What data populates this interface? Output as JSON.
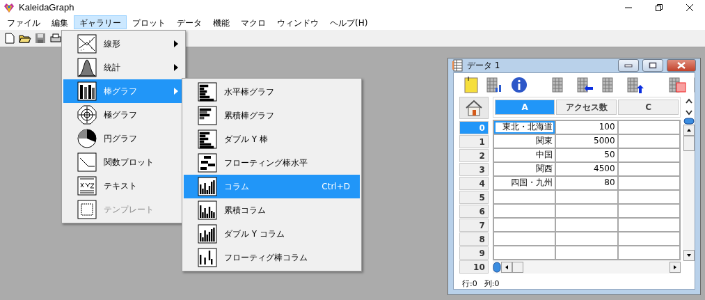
{
  "window": {
    "title": "KaleidaGraph"
  },
  "menu_bar": [
    {
      "label": "ファイル",
      "selected": false
    },
    {
      "label": "編集",
      "selected": false
    },
    {
      "label": "ギャラリー",
      "selected": true
    },
    {
      "label": "プロット",
      "selected": false
    },
    {
      "label": "データ",
      "selected": false
    },
    {
      "label": "機能",
      "selected": false
    },
    {
      "label": "マクロ",
      "selected": false
    },
    {
      "label": "ウィンドウ",
      "selected": false
    },
    {
      "label": "ヘルプ(H)",
      "selected": false
    }
  ],
  "gallery_menu": {
    "items": [
      {
        "label": "線形",
        "has_submenu": true,
        "selected": false,
        "disabled": false
      },
      {
        "label": "統計",
        "has_submenu": true,
        "selected": false,
        "disabled": false
      },
      {
        "label": "棒グラフ",
        "has_submenu": true,
        "selected": true,
        "disabled": false
      },
      {
        "label": "極グラフ",
        "has_submenu": false,
        "selected": false,
        "disabled": false
      },
      {
        "label": "円グラフ",
        "has_submenu": false,
        "selected": false,
        "disabled": false
      },
      {
        "label": "関数プロット",
        "has_submenu": false,
        "selected": false,
        "disabled": false
      },
      {
        "label": "テキスト",
        "has_submenu": false,
        "selected": false,
        "disabled": false
      },
      {
        "label": "テンプレート",
        "has_submenu": false,
        "selected": false,
        "disabled": true
      }
    ]
  },
  "bar_submenu": {
    "items": [
      {
        "label": "水平棒グラフ",
        "selected": false
      },
      {
        "label": "累積棒グラフ",
        "selected": false
      },
      {
        "label": "ダブル Y 棒",
        "selected": false
      },
      {
        "label": "フローティング棒水平",
        "selected": false
      },
      {
        "label": "コラム",
        "selected": true,
        "shortcut": "Ctrl+D"
      },
      {
        "label": "累積コラム",
        "selected": false
      },
      {
        "label": "ダブル Y コラム",
        "selected": false
      },
      {
        "label": "フローティグ棒コラム",
        "selected": false
      }
    ]
  },
  "data_window": {
    "title": "データ 1",
    "columns": [
      {
        "label": "A",
        "selected": true
      },
      {
        "label": "アクセス数",
        "selected": false
      },
      {
        "label": "C",
        "selected": false
      }
    ],
    "rows": [
      {
        "index": "0",
        "selected": true,
        "cells": [
          {
            "value": "東北・北海道",
            "active": true
          },
          {
            "value": "100",
            "active": false
          }
        ]
      },
      {
        "index": "1",
        "selected": false,
        "cells": [
          {
            "value": "関東",
            "active": false
          },
          {
            "value": "5000",
            "active": false
          }
        ]
      },
      {
        "index": "2",
        "selected": false,
        "cells": [
          {
            "value": "中国",
            "active": false
          },
          {
            "value": "50",
            "active": false
          }
        ]
      },
      {
        "index": "3",
        "selected": false,
        "cells": [
          {
            "value": "関西",
            "active": false
          },
          {
            "value": "4500",
            "active": false
          }
        ]
      },
      {
        "index": "4",
        "selected": false,
        "cells": [
          {
            "value": "四国・九州",
            "active": false
          },
          {
            "value": "80",
            "active": false
          }
        ]
      },
      {
        "index": "5",
        "selected": false
      },
      {
        "index": "6",
        "selected": false
      },
      {
        "index": "7",
        "selected": false
      },
      {
        "index": "8",
        "selected": false
      },
      {
        "index": "9",
        "selected": false
      },
      {
        "index": "10",
        "selected": false
      }
    ],
    "status": {
      "row": "行:0",
      "column": "列:0"
    }
  }
}
